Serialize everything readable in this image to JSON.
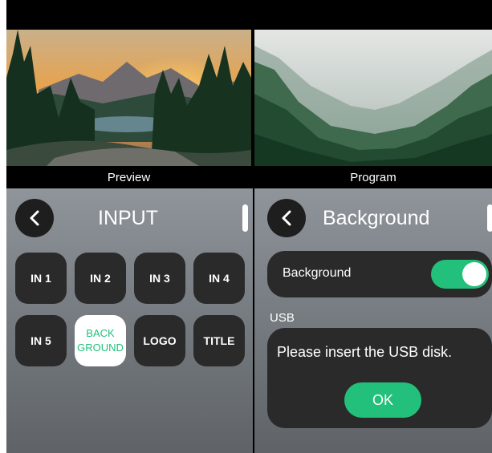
{
  "preview": {
    "label": "Preview",
    "image": "mountain-sunset-forest-lake"
  },
  "program": {
    "label": "Program",
    "image": "misty-forest-valley"
  },
  "input_panel": {
    "back_icon": "chevron-left-icon",
    "title": "INPUT",
    "buttons": [
      {
        "label": "IN 1",
        "selected": false
      },
      {
        "label": "IN 2",
        "selected": false
      },
      {
        "label": "IN 3",
        "selected": false
      },
      {
        "label": "IN 4",
        "selected": false
      },
      {
        "label": "IN 5",
        "selected": false
      },
      {
        "label": "BACK\nGROUND",
        "selected": true
      },
      {
        "label": "LOGO",
        "selected": false
      },
      {
        "label": "TITLE",
        "selected": false
      }
    ]
  },
  "background_panel": {
    "back_icon": "chevron-left-icon",
    "title": "Background",
    "toggle_label": "Background",
    "toggle_on": true,
    "usb_label": "USB",
    "usb_message": "Please insert the USB disk.",
    "ok_label": "OK"
  },
  "colors": {
    "accent": "#22c07a",
    "button": "#2a2a2a",
    "selected_button": "#ffffff"
  }
}
